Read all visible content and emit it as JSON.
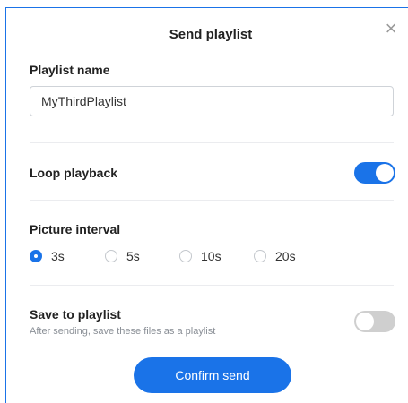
{
  "dialog": {
    "title": "Send playlist"
  },
  "playlist_name": {
    "label": "Playlist name",
    "value": "MyThirdPlaylist"
  },
  "loop_playback": {
    "label": "Loop playback",
    "enabled": true
  },
  "picture_interval": {
    "label": "Picture interval",
    "options": [
      "3s",
      "5s",
      "10s",
      "20s"
    ],
    "selected": "3s"
  },
  "save_to_playlist": {
    "label": "Save to playlist",
    "description": "After sending, save these files as a playlist",
    "enabled": false
  },
  "actions": {
    "confirm_label": "Confirm send"
  },
  "colors": {
    "accent": "#1a73e8",
    "toggle_off": "#cfcfcf"
  },
  "icons": {
    "close": "close-icon"
  }
}
